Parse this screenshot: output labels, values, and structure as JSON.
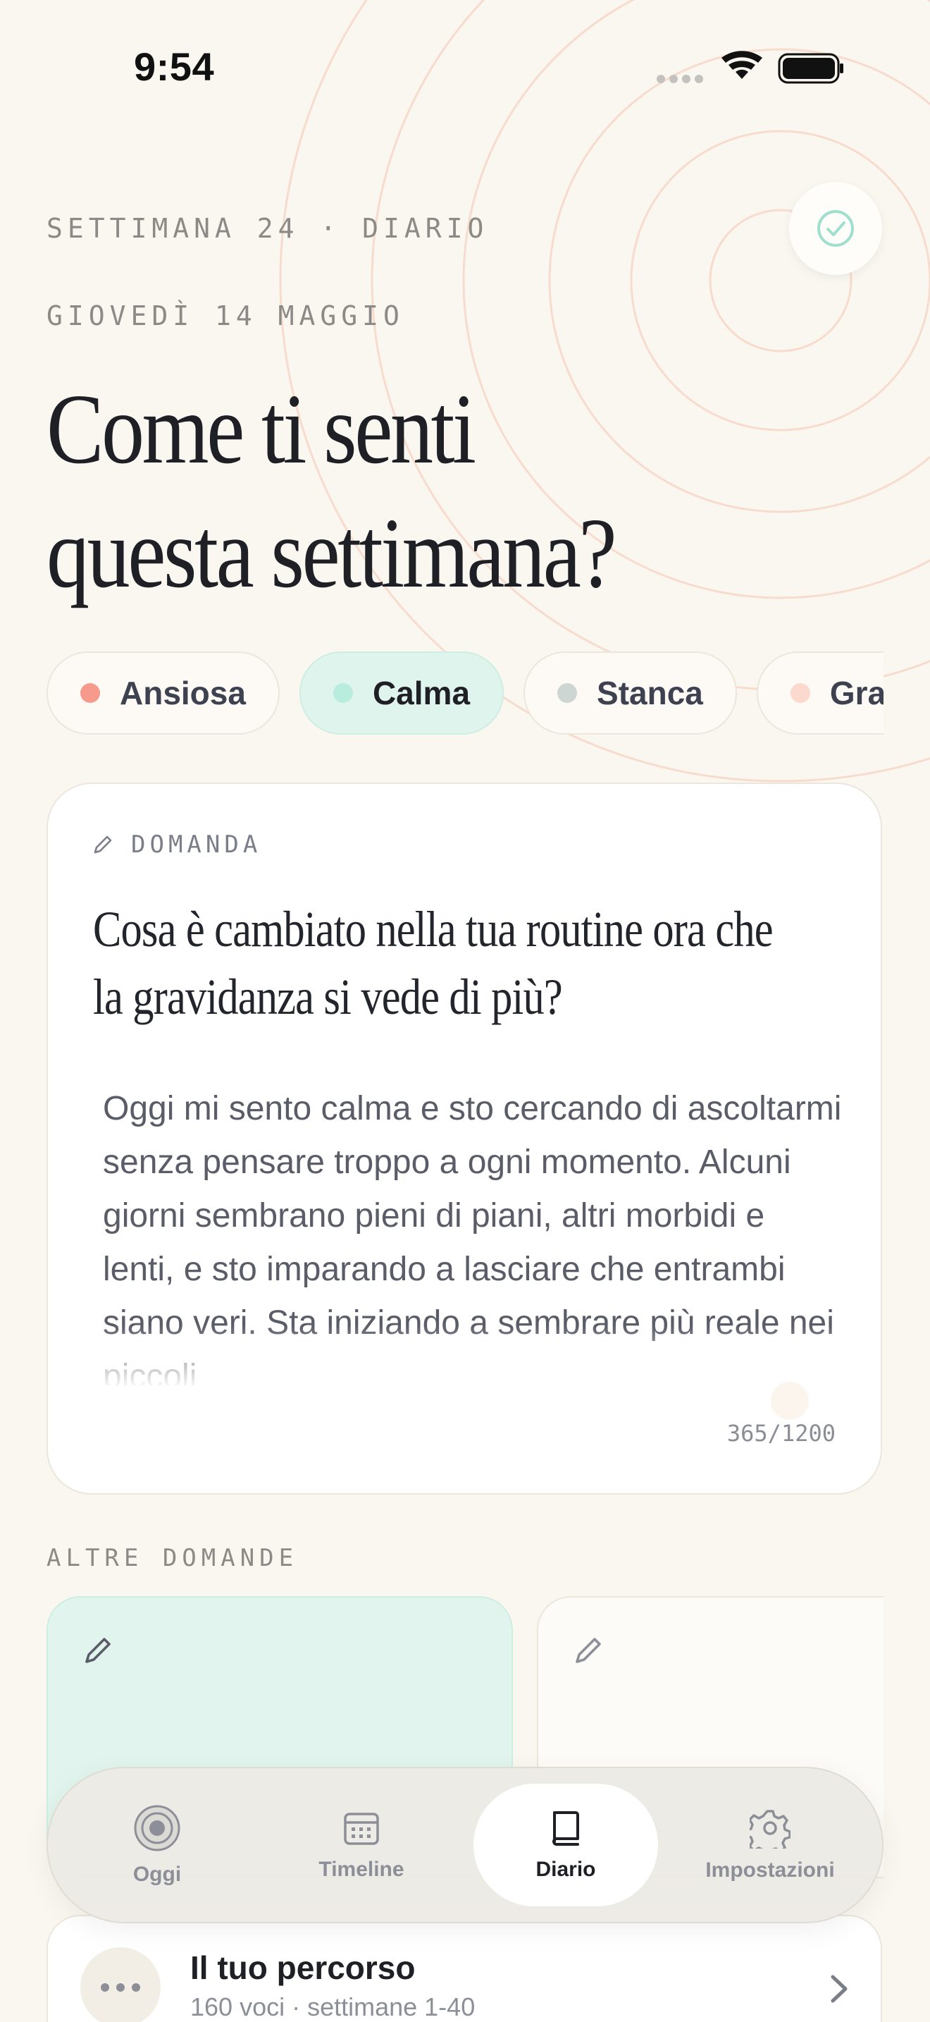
{
  "status_bar": {
    "time": "9:54"
  },
  "header": {
    "week_label": "SETTIMANA 24 · DIARIO",
    "date_label": "GIOVEDÌ 14 MAGGIO",
    "title_line1": "Come ti senti",
    "title_line2": "questa settimana?"
  },
  "moods": [
    {
      "label": "Ansiosa",
      "color": "#f59a8c",
      "selected": false
    },
    {
      "label": "Calma",
      "color": "#b8ecdd",
      "selected": true
    },
    {
      "label": "Stanca",
      "color": "#cdd6d2",
      "selected": false
    },
    {
      "label": "Grat",
      "color": "#fcd9ce",
      "selected": false
    }
  ],
  "question_card": {
    "label": "DOMANDA",
    "question": "Cosa è cambiato nella tua routine ora che la gravidanza si vede di più?",
    "answer": "Oggi mi sento calma e sto cercando di ascoltarmi senza pensare troppo a ogni momento. Alcuni giorni sembrano pieni di piani, altri morbidi e lenti, e sto imparando a lasciare che entrambi siano veri. Sta iniziando a sembrare più reale nei piccoli",
    "counter": "365/1200"
  },
  "other_questions": {
    "label": "ALTRE DOMANDE"
  },
  "tabs": [
    {
      "label": "Oggi",
      "icon": "target-icon",
      "active": false
    },
    {
      "label": "Timeline",
      "icon": "calendar-icon",
      "active": false
    },
    {
      "label": "Diario",
      "icon": "book-icon",
      "active": true
    },
    {
      "label": "Impostazioni",
      "icon": "gear-icon",
      "active": false
    }
  ],
  "path_card": {
    "title": "Il tuo percorso",
    "subtitle": "160 voci · settimane 1-40"
  },
  "colors": {
    "background": "#faf6f0",
    "accent_mint": "#e0f4ee",
    "ring_color": "#f6d7c6",
    "text_dark": "#1e2026"
  }
}
